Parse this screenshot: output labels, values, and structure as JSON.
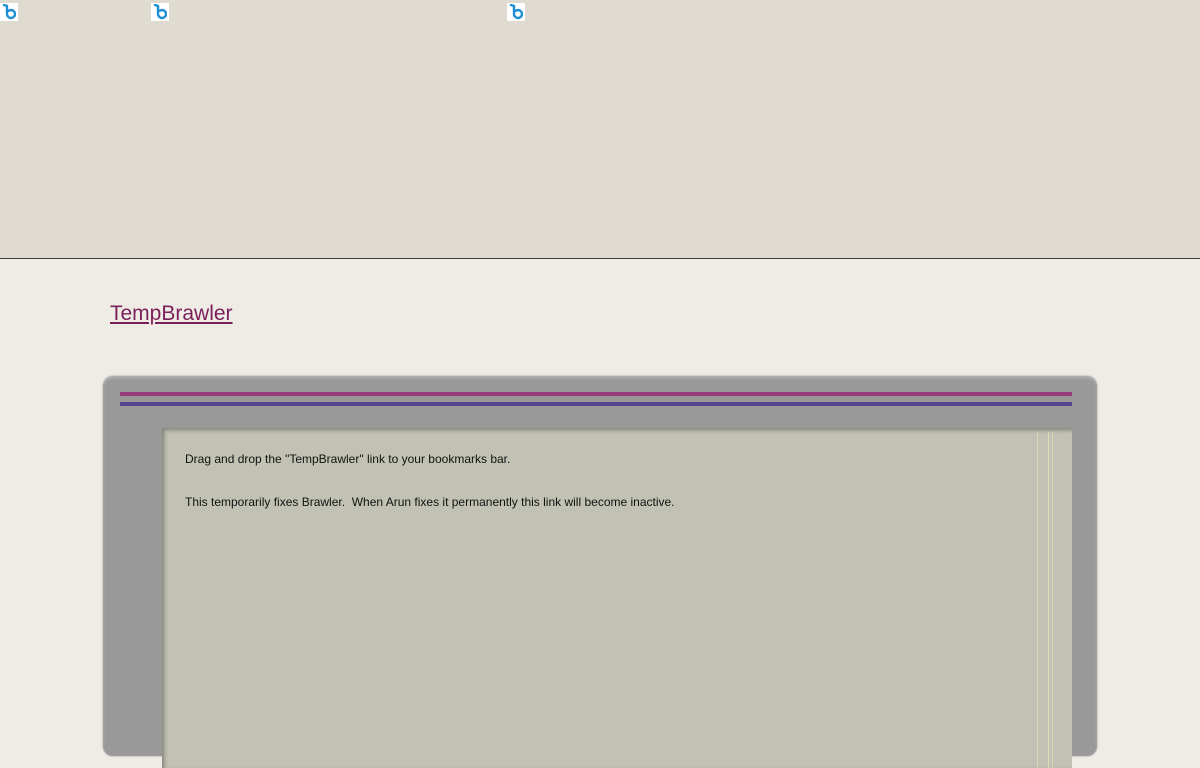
{
  "header": {
    "icons": [
      "bing-icon",
      "bing-icon",
      "bing-icon"
    ]
  },
  "main": {
    "bookmarklet_label": "TempBrawler",
    "instructions": [
      "Drag and drop the \"TempBrawler\" link to your bookmarks bar.",
      "This temporarily fixes Brawler.  When Arun fixes it permanently this link will become inactive."
    ]
  },
  "colors": {
    "link": "#7a1f5c",
    "stripe_top": "#973c7a",
    "stripe_bottom": "#54448d",
    "panel": "#c2c2b4",
    "frame": "#999999",
    "icon_blue": "#1d8fd6"
  }
}
